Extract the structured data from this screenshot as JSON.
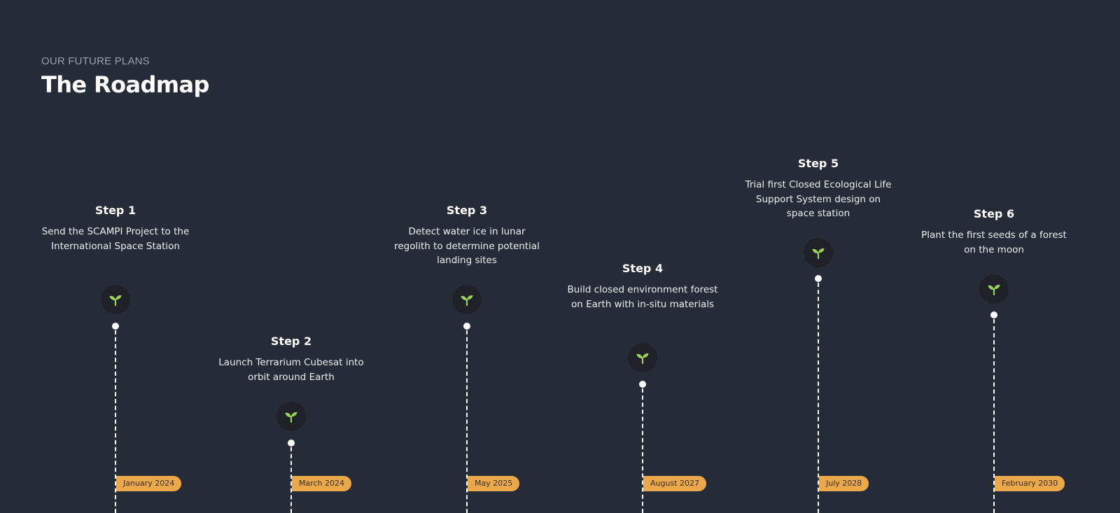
{
  "header": {
    "eyebrow": "OUR FUTURE PLANS",
    "title": "The Roadmap"
  },
  "colors": {
    "background": "#252c38",
    "badge": "#eaa84a",
    "icon_background": "#1e2127",
    "icon_sprout": "#9bd35a"
  },
  "steps": [
    {
      "title": "Step 1",
      "description": "Send the SCAMPI Project to the International Space Station",
      "icon": "sprout-icon",
      "date": "January 2024"
    },
    {
      "title": "Step 2",
      "description": "Launch Terrarium Cubesat into orbit around Earth",
      "icon": "sprout-icon",
      "date": "March 2024"
    },
    {
      "title": "Step 3",
      "description": "Detect water ice in lunar regolith to determine potential landing sites",
      "icon": "sprout-icon",
      "date": "May 2025"
    },
    {
      "title": "Step 4",
      "description": "Build closed environment forest on Earth with in-situ materials",
      "icon": "sprout-icon",
      "date": "August 2027"
    },
    {
      "title": "Step 5",
      "description": "Trial first Closed Ecological Life Support System design on space station",
      "icon": "sprout-icon",
      "date": "July 2028"
    },
    {
      "title": "Step 6",
      "description": "Plant the first seeds of a forest on the moon",
      "icon": "sprout-icon",
      "date": "February 2030"
    }
  ]
}
